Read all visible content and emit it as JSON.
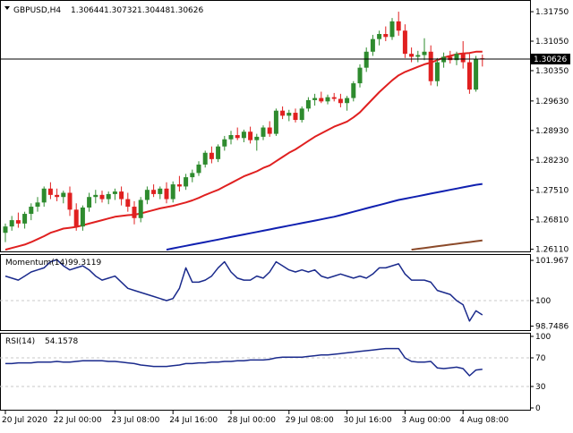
{
  "header": {
    "symbol": "GBPUSD,H4",
    "open": "1.30644",
    "high": "1.30732",
    "low": "1.30448",
    "close": "1.30626"
  },
  "colors": {
    "bull": "#2e8b2e",
    "bear": "#e02020",
    "ma_fast": "#e02020",
    "ma_mid": "#1020b0",
    "ma_slow": "#8b4a2a",
    "indicator": "#1a2a8c",
    "current_price_bg": "#000000",
    "current_price_fg": "#ffffff"
  },
  "chart_data": [
    {
      "type": "candlestick",
      "title": "GBPUSD,H4",
      "y_ticks": [
        "1.31750",
        "1.31050",
        "1.30350",
        "1.29630",
        "1.28930",
        "1.28230",
        "1.27510",
        "1.26810",
        "1.26110"
      ],
      "ylim": [
        1.2608,
        1.319
      ],
      "current_price": 1.30626,
      "current_price_label": "1.30626",
      "x_ticks": [
        "20 Jul 2020",
        "22 Jul 00:00",
        "23 Jul 08:00",
        "24 Jul 16:00",
        "28 Jul 00:00",
        "29 Jul 08:00",
        "30 Jul 16:00",
        "3 Aug 00:00",
        "4 Aug 08:00"
      ],
      "candles": [
        {
          "o": 1.265,
          "h": 1.2672,
          "l": 1.2628,
          "c": 1.2665
        },
        {
          "o": 1.2665,
          "h": 1.269,
          "l": 1.2655,
          "c": 1.268
        },
        {
          "o": 1.268,
          "h": 1.2698,
          "l": 1.2662,
          "c": 1.2672
        },
        {
          "o": 1.2672,
          "h": 1.27,
          "l": 1.266,
          "c": 1.2695
        },
        {
          "o": 1.2695,
          "h": 1.272,
          "l": 1.268,
          "c": 1.2712
        },
        {
          "o": 1.2712,
          "h": 1.2735,
          "l": 1.27,
          "c": 1.2722
        },
        {
          "o": 1.2722,
          "h": 1.276,
          "l": 1.2712,
          "c": 1.2755
        },
        {
          "o": 1.2755,
          "h": 1.277,
          "l": 1.273,
          "c": 1.274
        },
        {
          "o": 1.274,
          "h": 1.2755,
          "l": 1.2725,
          "c": 1.2735
        },
        {
          "o": 1.2735,
          "h": 1.275,
          "l": 1.272,
          "c": 1.2745
        },
        {
          "o": 1.2745,
          "h": 1.276,
          "l": 1.269,
          "c": 1.2705
        },
        {
          "o": 1.2705,
          "h": 1.272,
          "l": 1.2655,
          "c": 1.2665
        },
        {
          "o": 1.2665,
          "h": 1.2715,
          "l": 1.2655,
          "c": 1.271
        },
        {
          "o": 1.271,
          "h": 1.2745,
          "l": 1.27,
          "c": 1.2735
        },
        {
          "o": 1.2735,
          "h": 1.2752,
          "l": 1.272,
          "c": 1.274
        },
        {
          "o": 1.274,
          "h": 1.275,
          "l": 1.2722,
          "c": 1.273
        },
        {
          "o": 1.273,
          "h": 1.2748,
          "l": 1.2718,
          "c": 1.2742
        },
        {
          "o": 1.2742,
          "h": 1.2755,
          "l": 1.2728,
          "c": 1.2748
        },
        {
          "o": 1.2748,
          "h": 1.276,
          "l": 1.2715,
          "c": 1.273
        },
        {
          "o": 1.273,
          "h": 1.2745,
          "l": 1.27,
          "c": 1.2712
        },
        {
          "o": 1.2712,
          "h": 1.2725,
          "l": 1.267,
          "c": 1.2685
        },
        {
          "o": 1.2685,
          "h": 1.2735,
          "l": 1.2675,
          "c": 1.2728
        },
        {
          "o": 1.2728,
          "h": 1.276,
          "l": 1.2718,
          "c": 1.2752
        },
        {
          "o": 1.2752,
          "h": 1.2765,
          "l": 1.2735,
          "c": 1.2742
        },
        {
          "o": 1.2742,
          "h": 1.276,
          "l": 1.273,
          "c": 1.2755
        },
        {
          "o": 1.2755,
          "h": 1.277,
          "l": 1.272,
          "c": 1.273
        },
        {
          "o": 1.273,
          "h": 1.2772,
          "l": 1.2722,
          "c": 1.2765
        },
        {
          "o": 1.2765,
          "h": 1.2785,
          "l": 1.2748,
          "c": 1.276
        },
        {
          "o": 1.276,
          "h": 1.279,
          "l": 1.2752,
          "c": 1.2782
        },
        {
          "o": 1.2782,
          "h": 1.28,
          "l": 1.277,
          "c": 1.2792
        },
        {
          "o": 1.2792,
          "h": 1.282,
          "l": 1.2785,
          "c": 1.2812
        },
        {
          "o": 1.2812,
          "h": 1.2845,
          "l": 1.2805,
          "c": 1.284
        },
        {
          "o": 1.284,
          "h": 1.2855,
          "l": 1.2815,
          "c": 1.2825
        },
        {
          "o": 1.2825,
          "h": 1.286,
          "l": 1.2818,
          "c": 1.2855
        },
        {
          "o": 1.2855,
          "h": 1.288,
          "l": 1.2845,
          "c": 1.2872
        },
        {
          "o": 1.2872,
          "h": 1.2892,
          "l": 1.286,
          "c": 1.2882
        },
        {
          "o": 1.2882,
          "h": 1.29,
          "l": 1.287,
          "c": 1.2875
        },
        {
          "o": 1.2875,
          "h": 1.2895,
          "l": 1.2865,
          "c": 1.289
        },
        {
          "o": 1.289,
          "h": 1.2902,
          "l": 1.2862,
          "c": 1.287
        },
        {
          "o": 1.287,
          "h": 1.2885,
          "l": 1.2845,
          "c": 1.2878
        },
        {
          "o": 1.2878,
          "h": 1.2905,
          "l": 1.287,
          "c": 1.29
        },
        {
          "o": 1.29,
          "h": 1.2915,
          "l": 1.2878,
          "c": 1.2885
        },
        {
          "o": 1.2885,
          "h": 1.2945,
          "l": 1.288,
          "c": 1.294
        },
        {
          "o": 1.294,
          "h": 1.295,
          "l": 1.292,
          "c": 1.2928
        },
        {
          "o": 1.2928,
          "h": 1.2942,
          "l": 1.2915,
          "c": 1.2935
        },
        {
          "o": 1.2935,
          "h": 1.2945,
          "l": 1.2912,
          "c": 1.2918
        },
        {
          "o": 1.2918,
          "h": 1.295,
          "l": 1.2912,
          "c": 1.2945
        },
        {
          "o": 1.2945,
          "h": 1.2972,
          "l": 1.2938,
          "c": 1.2965
        },
        {
          "o": 1.2965,
          "h": 1.298,
          "l": 1.2952,
          "c": 1.297
        },
        {
          "o": 1.297,
          "h": 1.2985,
          "l": 1.2958,
          "c": 1.2962
        },
        {
          "o": 1.2962,
          "h": 1.2978,
          "l": 1.2955,
          "c": 1.2972
        },
        {
          "o": 1.2972,
          "h": 1.2982,
          "l": 1.2962,
          "c": 1.2968
        },
        {
          "o": 1.2968,
          "h": 1.298,
          "l": 1.2948,
          "c": 1.2958
        },
        {
          "o": 1.2958,
          "h": 1.2975,
          "l": 1.294,
          "c": 1.297
        },
        {
          "o": 1.297,
          "h": 1.301,
          "l": 1.2962,
          "c": 1.3005
        },
        {
          "o": 1.3005,
          "h": 1.305,
          "l": 1.2995,
          "c": 1.3042
        },
        {
          "o": 1.3042,
          "h": 1.309,
          "l": 1.3032,
          "c": 1.308
        },
        {
          "o": 1.308,
          "h": 1.312,
          "l": 1.307,
          "c": 1.311
        },
        {
          "o": 1.311,
          "h": 1.313,
          "l": 1.3095,
          "c": 1.3122
        },
        {
          "o": 1.3122,
          "h": 1.314,
          "l": 1.3105,
          "c": 1.3115
        },
        {
          "o": 1.3115,
          "h": 1.316,
          "l": 1.3108,
          "c": 1.3152
        },
        {
          "o": 1.3152,
          "h": 1.3175,
          "l": 1.3118,
          "c": 1.313
        },
        {
          "o": 1.313,
          "h": 1.3145,
          "l": 1.3065,
          "c": 1.3075
        },
        {
          "o": 1.3075,
          "h": 1.309,
          "l": 1.3055,
          "c": 1.3068
        },
        {
          "o": 1.3068,
          "h": 1.3082,
          "l": 1.3055,
          "c": 1.3072
        },
        {
          "o": 1.3072,
          "h": 1.3112,
          "l": 1.306,
          "c": 1.308
        },
        {
          "o": 1.308,
          "h": 1.3095,
          "l": 1.3,
          "c": 1.301
        },
        {
          "o": 1.301,
          "h": 1.3065,
          "l": 1.2998,
          "c": 1.3055
        },
        {
          "o": 1.3055,
          "h": 1.3078,
          "l": 1.3042,
          "c": 1.3068
        },
        {
          "o": 1.3068,
          "h": 1.3082,
          "l": 1.3052,
          "c": 1.306
        },
        {
          "o": 1.306,
          "h": 1.308,
          "l": 1.3048,
          "c": 1.3075
        },
        {
          "o": 1.3075,
          "h": 1.3105,
          "l": 1.304,
          "c": 1.3055
        },
        {
          "o": 1.3055,
          "h": 1.3075,
          "l": 1.298,
          "c": 1.299
        },
        {
          "o": 1.299,
          "h": 1.307,
          "l": 1.2985,
          "c": 1.3063
        },
        {
          "o": 1.30644,
          "h": 1.30732,
          "l": 1.30448,
          "c": 1.30626
        }
      ],
      "ma_fast": [
        1.261,
        1.2614,
        1.2618,
        1.2622,
        1.2628,
        1.2635,
        1.2642,
        1.265,
        1.2655,
        1.266,
        1.2662,
        1.2664,
        1.2668,
        1.2672,
        1.2676,
        1.268,
        1.2684,
        1.2688,
        1.269,
        1.2692,
        1.2693,
        1.2696,
        1.27,
        1.2704,
        1.2708,
        1.2711,
        1.2714,
        1.2718,
        1.2722,
        1.2727,
        1.2733,
        1.274,
        1.2746,
        1.2752,
        1.276,
        1.2768,
        1.2776,
        1.2784,
        1.279,
        1.2796,
        1.2804,
        1.281,
        1.282,
        1.283,
        1.284,
        1.2848,
        1.2858,
        1.2868,
        1.2878,
        1.2886,
        1.2894,
        1.2902,
        1.2908,
        1.2914,
        1.2924,
        1.2936,
        1.2952,
        1.2968,
        1.2984,
        1.2998,
        1.3012,
        1.3024,
        1.3032,
        1.3038,
        1.3044,
        1.305,
        1.3054,
        1.306,
        1.3066,
        1.307,
        1.3074,
        1.3076,
        1.3077,
        1.308,
        1.308
      ],
      "ma_mid": [
        null,
        null,
        null,
        null,
        null,
        null,
        null,
        null,
        null,
        null,
        null,
        null,
        null,
        null,
        null,
        null,
        null,
        null,
        null,
        null,
        null,
        null,
        null,
        null,
        null,
        1.261,
        1.2613,
        1.2616,
        1.2619,
        1.2622,
        1.2625,
        1.2628,
        1.2631,
        1.2634,
        1.2637,
        1.264,
        1.2643,
        1.2646,
        1.2649,
        1.2652,
        1.2655,
        1.2658,
        1.2661,
        1.2664,
        1.2667,
        1.267,
        1.2673,
        1.2676,
        1.2679,
        1.2682,
        1.2685,
        1.2688,
        1.2692,
        1.2696,
        1.27,
        1.2704,
        1.2708,
        1.2712,
        1.2716,
        1.272,
        1.2724,
        1.2728,
        1.2731,
        1.2734,
        1.2737,
        1.274,
        1.2743,
        1.2746,
        1.2749,
        1.2752,
        1.2755,
        1.2758,
        1.2761,
        1.2764,
        1.2766
      ],
      "ma_slow": [
        null,
        null,
        null,
        null,
        null,
        null,
        null,
        null,
        null,
        null,
        null,
        null,
        null,
        null,
        null,
        null,
        null,
        null,
        null,
        null,
        null,
        null,
        null,
        null,
        null,
        null,
        null,
        null,
        null,
        null,
        null,
        null,
        null,
        null,
        null,
        null,
        null,
        null,
        null,
        null,
        null,
        null,
        null,
        null,
        null,
        null,
        null,
        null,
        null,
        null,
        null,
        null,
        null,
        null,
        null,
        null,
        null,
        null,
        null,
        null,
        null,
        null,
        null,
        1.261,
        1.2612,
        1.2614,
        1.2616,
        1.2618,
        1.262,
        1.2622,
        1.2624,
        1.2626,
        1.2628,
        1.263,
        1.2632
      ]
    },
    {
      "type": "line",
      "title": "Momentum(14) 99.3119",
      "label": "Momentum(14)",
      "value_label": "99.3119",
      "y_ticks": [
        "101.967",
        "100",
        "98.7486"
      ],
      "ylim": [
        98.6,
        102.1
      ],
      "ref_level": 100,
      "values": [
        101.2,
        101.1,
        101.0,
        101.2,
        101.4,
        101.5,
        101.6,
        101.9,
        102.0,
        101.7,
        101.5,
        101.6,
        101.7,
        101.5,
        101.2,
        101.0,
        101.1,
        101.2,
        100.9,
        100.6,
        100.5,
        100.4,
        100.3,
        100.2,
        100.1,
        100.0,
        100.1,
        100.6,
        101.6,
        100.9,
        100.9,
        101.0,
        101.2,
        101.6,
        101.9,
        101.4,
        101.1,
        101.0,
        101.0,
        101.2,
        101.1,
        101.4,
        101.9,
        101.7,
        101.5,
        101.4,
        101.5,
        101.4,
        101.5,
        101.2,
        101.1,
        101.2,
        101.3,
        101.2,
        101.1,
        101.2,
        101.1,
        101.3,
        101.6,
        101.6,
        101.7,
        101.8,
        101.3,
        101.0,
        101.0,
        101.0,
        100.9,
        100.5,
        100.4,
        100.3,
        100.0,
        99.8,
        99.0,
        99.5,
        99.3
      ]
    },
    {
      "type": "line",
      "title": "RSI(14) 54.1578",
      "label": "RSI(14)",
      "value_label": "54.1578",
      "y_ticks": [
        "100",
        "70",
        "30",
        "0"
      ],
      "ylim": [
        0,
        100
      ],
      "levels": [
        70,
        30
      ],
      "values": [
        62,
        62,
        63,
        63,
        63,
        64,
        64,
        64,
        65,
        64,
        64,
        65,
        66,
        66,
        66,
        66,
        65,
        65,
        64,
        63,
        62,
        60,
        59,
        58,
        58,
        58,
        59,
        60,
        62,
        62,
        63,
        63,
        64,
        64,
        65,
        65,
        66,
        66,
        67,
        67,
        67,
        68,
        70,
        71,
        71,
        71,
        71,
        72,
        73,
        74,
        74,
        75,
        76,
        77,
        78,
        79,
        80,
        81,
        82,
        83,
        83,
        83,
        70,
        65,
        64,
        64,
        65,
        56,
        55,
        56,
        57,
        55,
        45,
        53,
        54
      ]
    }
  ]
}
